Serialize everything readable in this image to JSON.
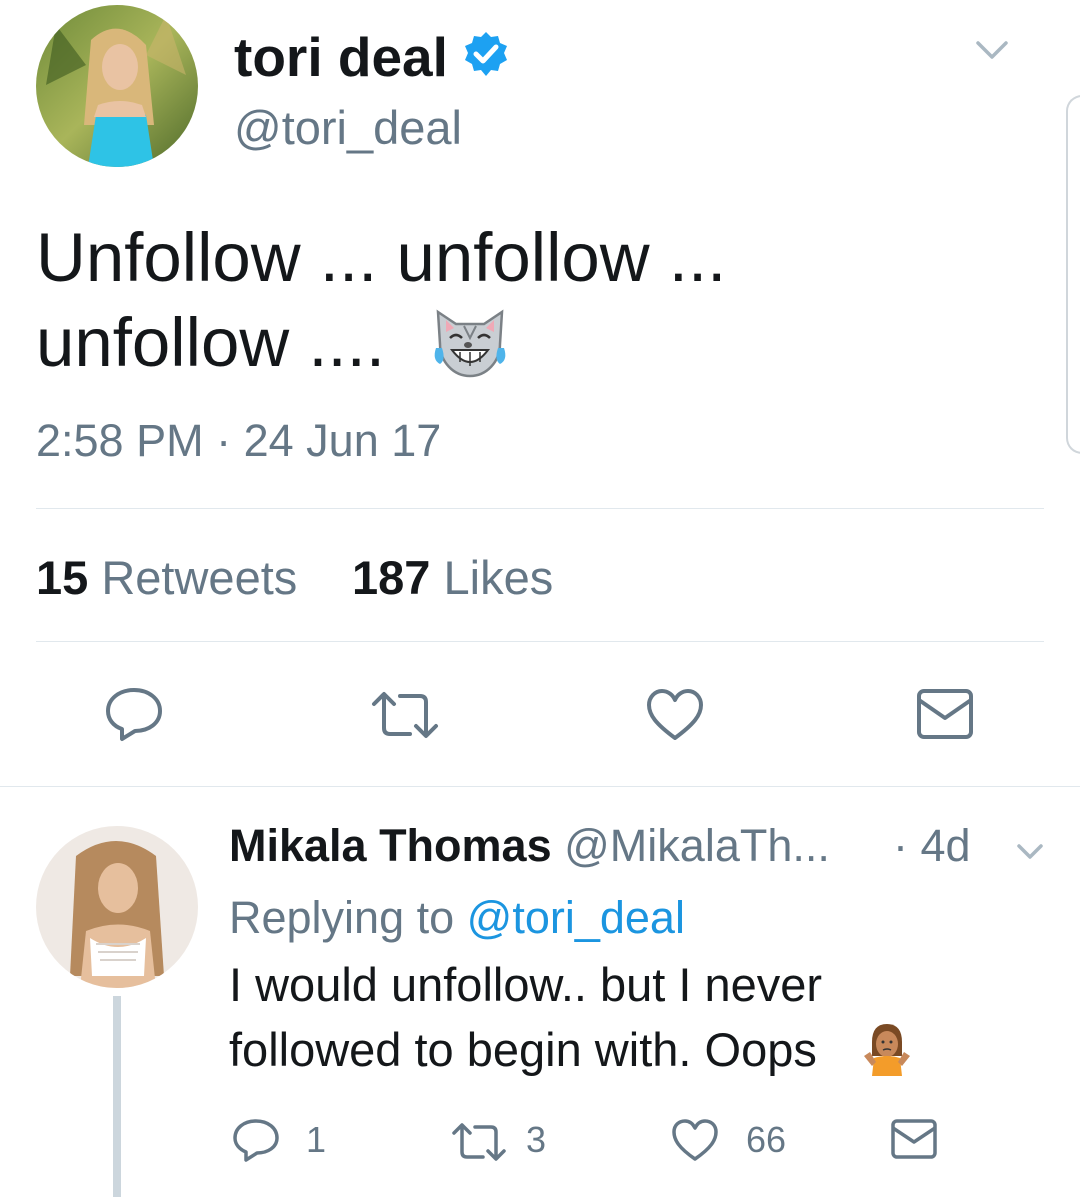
{
  "main_tweet": {
    "display_name": "tori deal",
    "handle": "@tori_deal",
    "text_line1": "Unfollow ... unfollow ...",
    "text_line2": "unfollow ....",
    "time": "2:58 PM",
    "separator": "·",
    "date": "24 Jun 17",
    "retweets_count": "15",
    "retweets_label": "Retweets",
    "likes_count": "187",
    "likes_label": "Likes"
  },
  "reply": {
    "display_name": "Mikala Thomas",
    "handle": "@MikalaTh...",
    "age": "· 4d",
    "replying_to_label": "Replying to",
    "replying_to_handle": "@tori_deal",
    "text_line1": "I would unfollow.. but I never",
    "text_line2": "followed to begin with. Oops",
    "reply_count": "1",
    "retweet_count": "3",
    "like_count": "66"
  },
  "colors": {
    "verified": "#1da1f2",
    "link": "#1b95e0",
    "secondary_text": "#657786",
    "divider": "#e1e8ed"
  }
}
